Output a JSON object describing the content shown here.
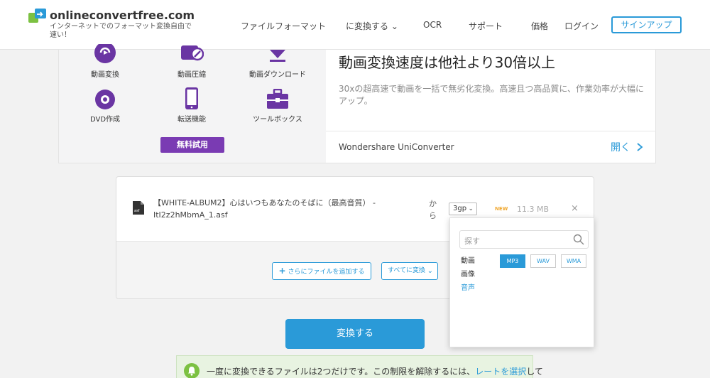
{
  "header": {
    "logo_name": "onlineconvertfree.com",
    "logo_tagline": "インターネットでのフォーマット変換自由で速い！",
    "nav": [
      "ファイルフォーマット",
      "に変換する ⌄",
      "OCR",
      "サポート",
      "価格",
      "ログイン"
    ],
    "signup_label": "サインアップ"
  },
  "promo": {
    "tools": [
      {
        "label": "動画変換",
        "icon": "video-convert-icon"
      },
      {
        "label": "動画圧縮",
        "icon": "video-compress-icon"
      },
      {
        "label": "動画ダウンロード",
        "icon": "download-icon"
      },
      {
        "label": "DVD作成",
        "icon": "dvd-icon"
      },
      {
        "label": "転送機能",
        "icon": "phone-transfer-icon"
      },
      {
        "label": "ツールボックス",
        "icon": "toolbox-icon"
      }
    ],
    "trial_label": "無料試用",
    "title": "動画変換速度は他社より30倍以上",
    "description": "30xの超高速で動画を一括で無劣化変換。高速且つ高品質に、作業効率が大幅にアップ。",
    "brand": "Wondershare UniConverter",
    "open_label": "開く"
  },
  "converter": {
    "file_name": "【WHITE-ALBUM2】心はいつもあなたのそばに（最高音質） - ItI2z2hMbmA_1.asf",
    "from_label": "から",
    "target_format": "3gp",
    "new_badge": "NEW",
    "file_size": "11.3 MB",
    "remove_symbol": "×",
    "add_more_label": "さらにファイルを追加する",
    "convert_all_label": "すべてに変換"
  },
  "dropdown": {
    "search_placeholder": "探す",
    "categories": [
      "動画",
      "画像",
      "音声"
    ],
    "active_category": "音声",
    "formats": [
      "MP3",
      "WAV",
      "WMA"
    ],
    "selected_format": "MP3"
  },
  "convert_button_label": "変換する",
  "notice": {
    "text": "一度に変換できるファイルは2つだけです。この制限を解除するには、",
    "link_text": "レートを選択",
    "suffix": "して"
  },
  "colors": {
    "accent": "#2a9ad8",
    "trial": "#7a3bb3",
    "new_badge": "#f0a830",
    "notice_bg": "#e8f3e1",
    "bell": "#7cc142"
  }
}
